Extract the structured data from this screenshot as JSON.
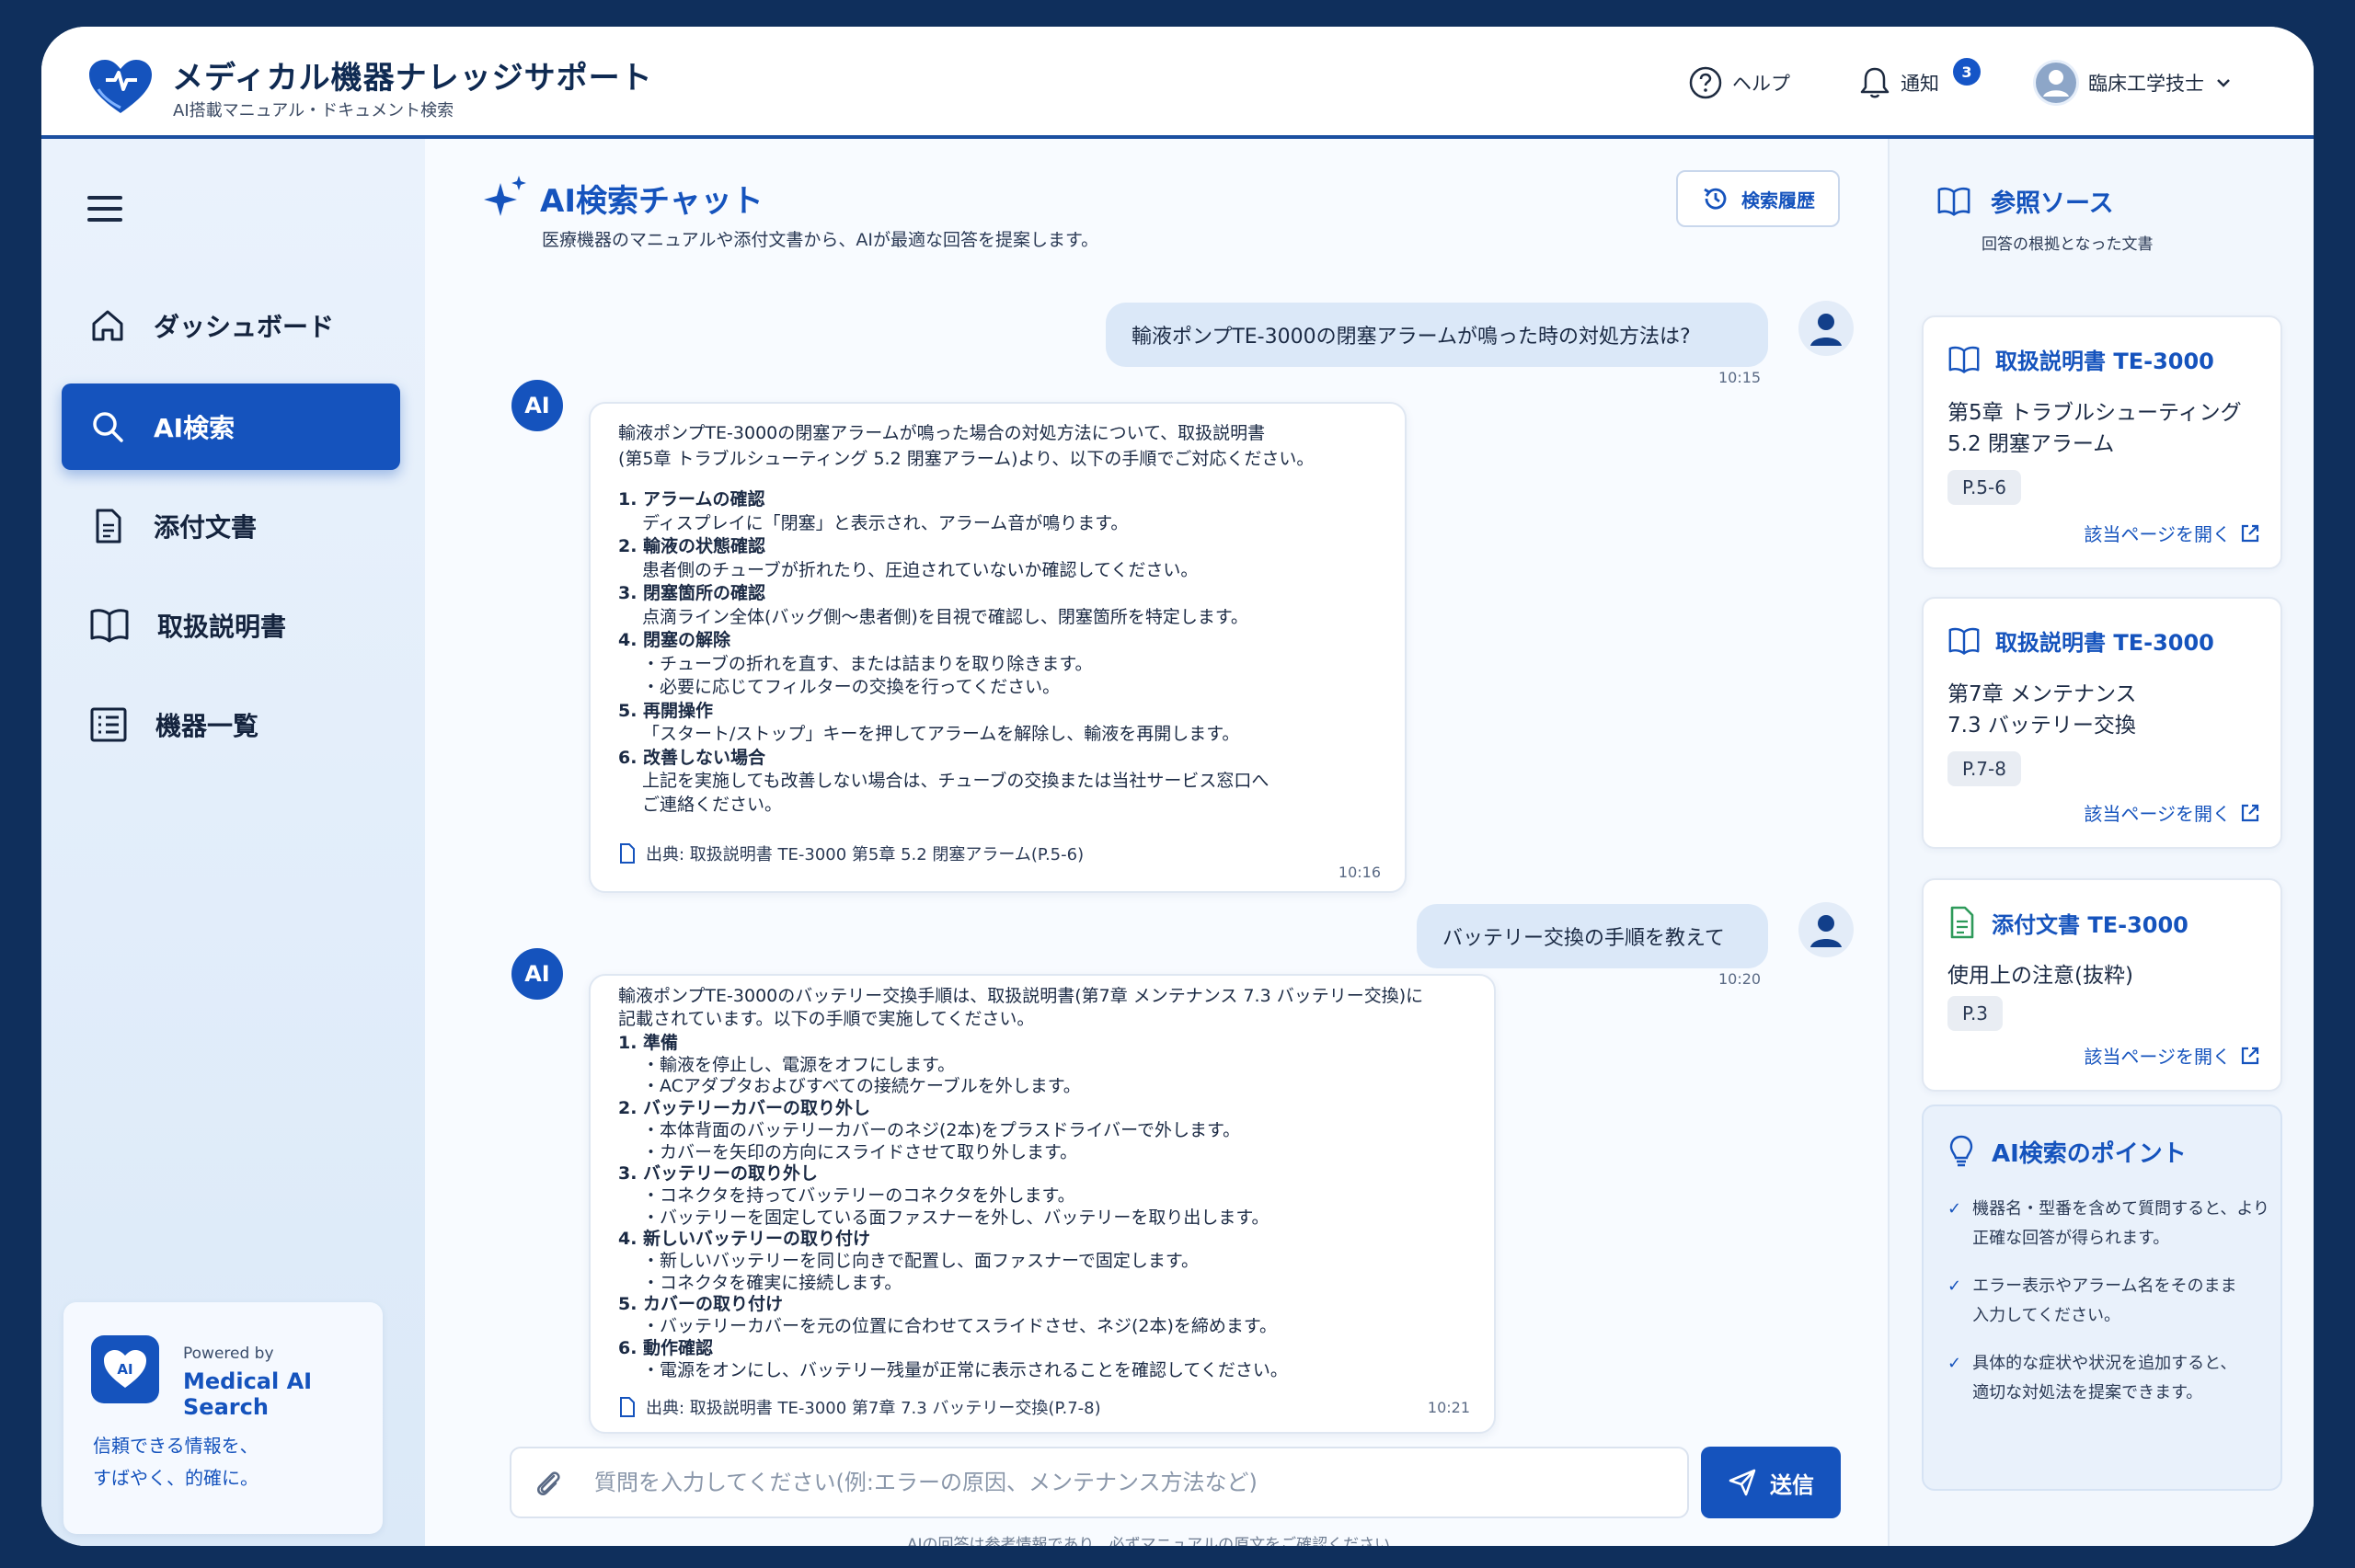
{
  "header": {
    "app_title": "メディカル機器ナレッジサポート",
    "app_subtitle": "AI搭載マニュアル・ドキュメント検索",
    "help_label": "ヘルプ",
    "notify_label": "通知",
    "notify_count": "3",
    "user_label": "臨床工学技士"
  },
  "sidebar": {
    "items": [
      {
        "label": "ダッシュボード",
        "icon": "home-icon"
      },
      {
        "label": "AI検索",
        "icon": "search-icon",
        "active": true
      },
      {
        "label": "添付文書",
        "icon": "document-icon"
      },
      {
        "label": "取扱説明書",
        "icon": "book-icon"
      },
      {
        "label": "機器一覧",
        "icon": "list-icon"
      }
    ],
    "powered": {
      "by": "Powered by",
      "name": "Medical AI Search",
      "msg1": "信頼できる情報を、",
      "msg2": "すばやく、的確に。"
    }
  },
  "chat": {
    "title": "AI検索チャット",
    "subtitle": "医療機器のマニュアルや添付文書から、AIが最適な回答を提案します。",
    "history_label": "検索履歴",
    "messages": [
      {
        "role": "user",
        "text": "輸液ポンプTE-3000の閉塞アラームが鳴った時の対処方法は?",
        "time": "10:15"
      },
      {
        "role": "ai",
        "avatar": "AI",
        "intro1": "輸液ポンプTE-3000の閉塞アラームが鳴った場合の対処方法について、取扱説明書",
        "intro2": "(第5章 トラブルシューティング 5.2 閉塞アラーム)より、以下の手順でご対応ください。",
        "steps": [
          {
            "title": "1. アラームの確認",
            "lines": [
              "ディスプレイに「閉塞」と表示され、アラーム音が鳴ります。"
            ]
          },
          {
            "title": "2. 輸液の状態確認",
            "lines": [
              "患者側のチューブが折れたり、圧迫されていないか確認してください。"
            ]
          },
          {
            "title": "3. 閉塞箇所の確認",
            "lines": [
              "点滴ライン全体(バッグ側〜患者側)を目視で確認し、閉塞箇所を特定します。"
            ]
          },
          {
            "title": "4. 閉塞の解除",
            "lines": [
              "・チューブの折れを直す、または詰まりを取り除きます。",
              "・必要に応じてフィルターの交換を行ってください。"
            ]
          },
          {
            "title": "5. 再開操作",
            "lines": [
              "「スタート/ストップ」キーを押してアラームを解除し、輸液を再開します。"
            ]
          },
          {
            "title": "6. 改善しない場合",
            "lines": [
              "上記を実施しても改善しない場合は、チューブの交換または当社サービス窓口へ",
              "ご連絡ください。"
            ]
          }
        ],
        "source": "出典: 取扱説明書 TE-3000 第5章 5.2 閉塞アラーム(P.5-6)",
        "time": "10:16"
      },
      {
        "role": "user",
        "text": "バッテリー交換の手順を教えて",
        "time": "10:20"
      },
      {
        "role": "ai",
        "avatar": "AI",
        "intro1": "輸液ポンプTE-3000のバッテリー交換手順は、取扱説明書(第7章 メンテナンス 7.3 バッテリー交換)に",
        "intro2": "記載されています。以下の手順で実施してください。",
        "steps": [
          {
            "title": "1. 準備",
            "lines": [
              "・輸液を停止し、電源をオフにします。",
              "・ACアダプタおよびすべての接続ケーブルを外します。"
            ]
          },
          {
            "title": "2. バッテリーカバーの取り外し",
            "lines": [
              "・本体背面のバッテリーカバーのネジ(2本)をプラスドライバーで外します。",
              "・カバーを矢印の方向にスライドさせて取り外します。"
            ]
          },
          {
            "title": "3. バッテリーの取り外し",
            "lines": [
              "・コネクタを持ってバッテリーのコネクタを外します。",
              "・バッテリーを固定している面ファスナーを外し、バッテリーを取り出します。"
            ]
          },
          {
            "title": "4. 新しいバッテリーの取り付け",
            "lines": [
              "・新しいバッテリーを同じ向きで配置し、面ファスナーで固定します。",
              "・コネクタを確実に接続します。"
            ]
          },
          {
            "title": "5. カバーの取り付け",
            "lines": [
              "・バッテリーカバーを元の位置に合わせてスライドさせ、ネジ(2本)を締めます。"
            ]
          },
          {
            "title": "6. 動作確認",
            "lines": [
              "・電源をオンにし、バッテリー残量が正常に表示されることを確認してください。"
            ]
          }
        ],
        "source": "出典: 取扱説明書 TE-3000 第7章 7.3 バッテリー交換(P.7-8)",
        "time": "10:21"
      }
    ],
    "input_placeholder": "質問を入力してください(例:エラーの原因、メンテナンス方法など)",
    "send_label": "送信",
    "disclaimer": "AIの回答は参考情報であり、必ずマニュアルの原文をご確認ください。"
  },
  "references": {
    "title": "参照ソース",
    "subtitle": "回答の根拠となった文書",
    "open_label": "該当ページを開く",
    "cards": [
      {
        "icon": "book-icon",
        "title": "取扱説明書 TE-3000",
        "line1": "第5章 トラブルシューティング",
        "line2": "5.2 閉塞アラーム",
        "page": "P.5-6"
      },
      {
        "icon": "book-icon",
        "title": "取扱説明書 TE-3000",
        "line1": "第7章 メンテナンス",
        "line2": "7.3 バッテリー交換",
        "page": "P.7-8"
      },
      {
        "icon": "document-icon",
        "title": "添付文書 TE-3000",
        "line1": "使用上の注意(抜粋)",
        "page": "P.3"
      }
    ],
    "tips": {
      "title": "AI検索のポイント",
      "items": [
        {
          "l1": "機器名・型番を含めて質問すると、より",
          "l2": "正確な回答が得られます。"
        },
        {
          "l1": "エラー表示やアラーム名をそのまま",
          "l2": "入力してください。"
        },
        {
          "l1": "具体的な症状や状況を追加すると、",
          "l2": "適切な対処法を提案できます。"
        }
      ]
    }
  },
  "colors": {
    "accent": "#1553bd",
    "frame": "#0f2f5c"
  }
}
